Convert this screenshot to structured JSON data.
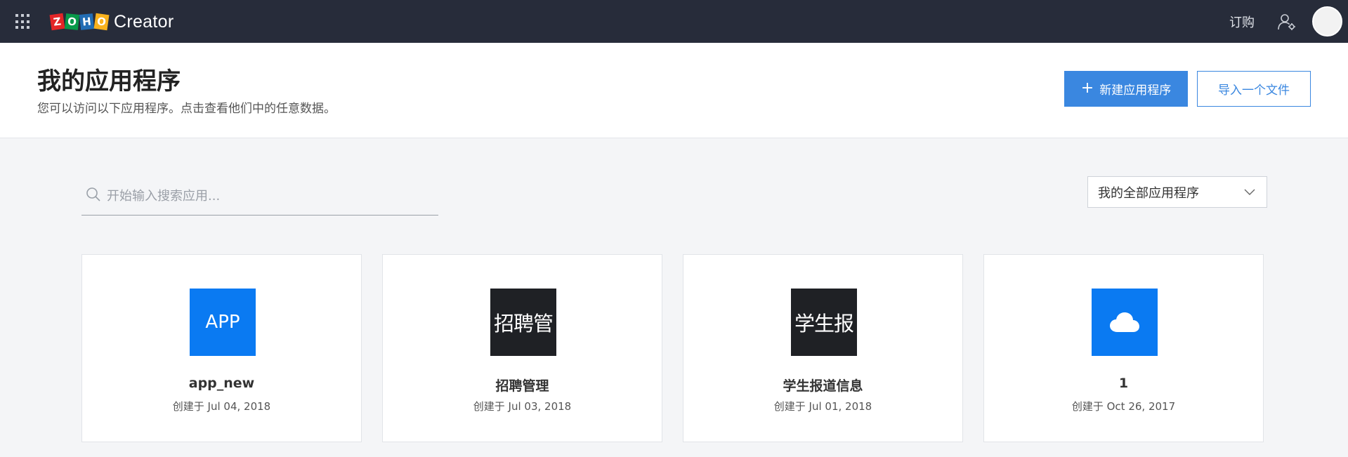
{
  "navbar": {
    "logo_letters": [
      "Z",
      "O",
      "H",
      "O"
    ],
    "product_name": "Creator",
    "subscribe_label": "订购"
  },
  "header": {
    "title": "我的应用程序",
    "subtitle": "您可以访问以下应用程序。点击查看他们中的任意数据。",
    "new_app_label": "新建应用程序",
    "new_app_plus": "+",
    "import_label": "导入一个文件"
  },
  "search": {
    "placeholder": "开始输入搜索应用...",
    "value": ""
  },
  "filter": {
    "selected": "我的全部应用程序"
  },
  "apps": [
    {
      "icon_text": "APP",
      "icon_color": "#0a7af2",
      "name": "app_new",
      "created": "创建于 Jul 04, 2018"
    },
    {
      "icon_text": "招聘管",
      "icon_color": "#1f2125",
      "name": "招聘管理",
      "created": "创建于 Jul 03, 2018"
    },
    {
      "icon_text": "学生报",
      "icon_color": "#1f2125",
      "name": "学生报道信息",
      "created": "创建于 Jul 01, 2018"
    },
    {
      "icon_text": "",
      "icon_name": "cloud-icon",
      "icon_color": "#0a7af2",
      "name": "1",
      "created": "创建于 Oct 26, 2017"
    }
  ],
  "colors": {
    "navbar_bg": "#272c3a",
    "accent": "#3a87e0",
    "page_bg": "#f4f5f7"
  }
}
